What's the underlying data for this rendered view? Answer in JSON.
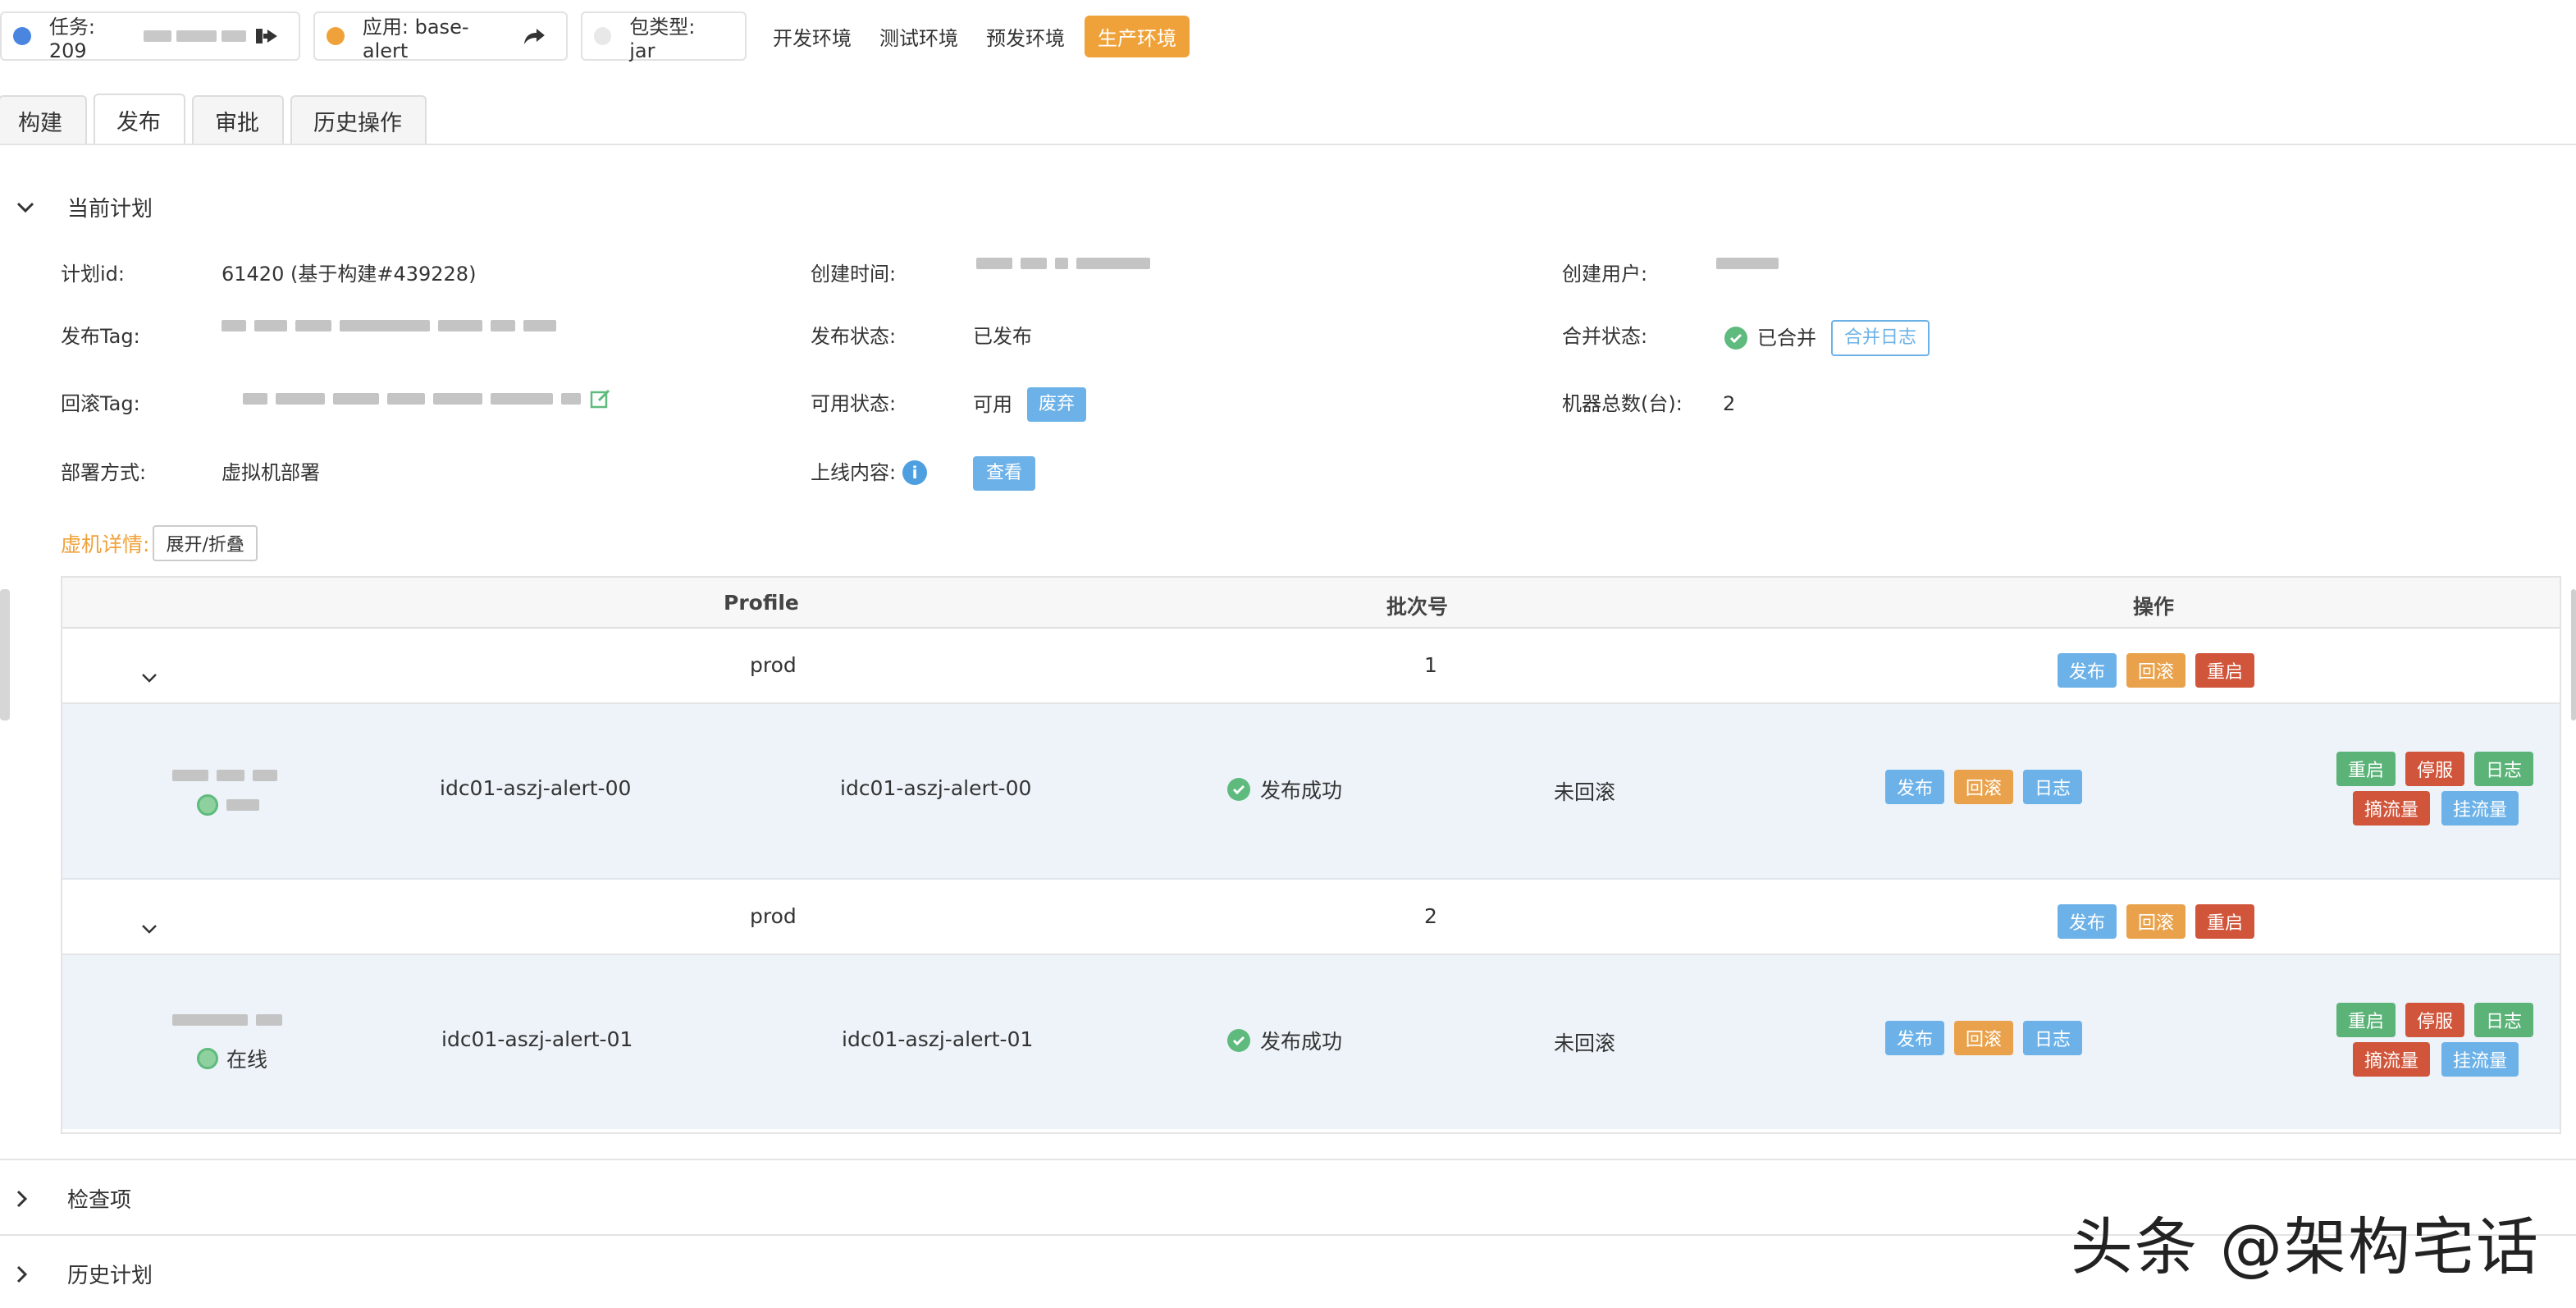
{
  "topbar": {
    "task_label": "任务: 209",
    "app_label": "应用: base-alert",
    "package_label": "包类型: jar",
    "envs": [
      "开发环境",
      "测试环境",
      "预发环境"
    ],
    "active_env": "生产环境",
    "colors": {
      "task_dot": "#4a86e0",
      "app_dot": "#f0a23a",
      "package_dot": "#e8e8e8",
      "active_env_bg": "#f0a23a"
    }
  },
  "tabs": [
    "构建",
    "发布",
    "审批",
    "历史操作"
  ],
  "active_tab": "发布",
  "current_plan": {
    "title": "当前计划",
    "fields": {
      "plan_id_label": "计划id:",
      "plan_id_value": "61420 (基于构建#439228)",
      "created_time_label": "创建时间:",
      "created_user_label": "创建用户:",
      "release_tag_label": "发布Tag:",
      "release_status_label": "发布状态:",
      "release_status_value": "已发布",
      "merge_status_label": "合并状态:",
      "merge_status_value": "已合并",
      "merge_log_button": "合并日志",
      "rollback_tag_label": "回滚Tag:",
      "available_status_label": "可用状态:",
      "available_status_value": "可用",
      "discard_button": "废弃",
      "machine_count_label": "机器总数(台):",
      "machine_count_value": "2",
      "deploy_mode_label": "部署方式:",
      "deploy_mode_value": "虚拟机部署",
      "online_content_label": "上线内容:",
      "view_button": "查看"
    },
    "vm_detail_label": "虚机详情:",
    "toggle_button": "展开/折叠"
  },
  "vm_table": {
    "columns": [
      "Profile",
      "批次号",
      "操作"
    ],
    "batches": [
      {
        "profile": "prod",
        "batch": "1",
        "actions": [
          "发布",
          "回滚",
          "重启"
        ],
        "host": {
          "hostname": "idc01-aszj-alert-00",
          "instance": "idc01-aszj-alert-00",
          "status": "发布成功",
          "rollback": "未回滚",
          "mid_actions": [
            "发布",
            "回滚",
            "日志"
          ],
          "right_actions_top": [
            "重启",
            "停服",
            "日志"
          ],
          "right_actions_bottom": [
            "摘流量",
            "挂流量"
          ]
        }
      },
      {
        "profile": "prod",
        "batch": "2",
        "actions": [
          "发布",
          "回滚",
          "重启"
        ],
        "host": {
          "online": "在线",
          "hostname": "idc01-aszj-alert-01",
          "instance": "idc01-aszj-alert-01",
          "status": "发布成功",
          "rollback": "未回滚",
          "mid_actions": [
            "发布",
            "回滚",
            "日志"
          ],
          "right_actions_top": [
            "重启",
            "停服",
            "日志"
          ],
          "right_actions_bottom": [
            "摘流量",
            "挂流量"
          ]
        }
      }
    ]
  },
  "sections": [
    "检查项",
    "历史计划"
  ],
  "watermark": "头条 @架构宅话"
}
